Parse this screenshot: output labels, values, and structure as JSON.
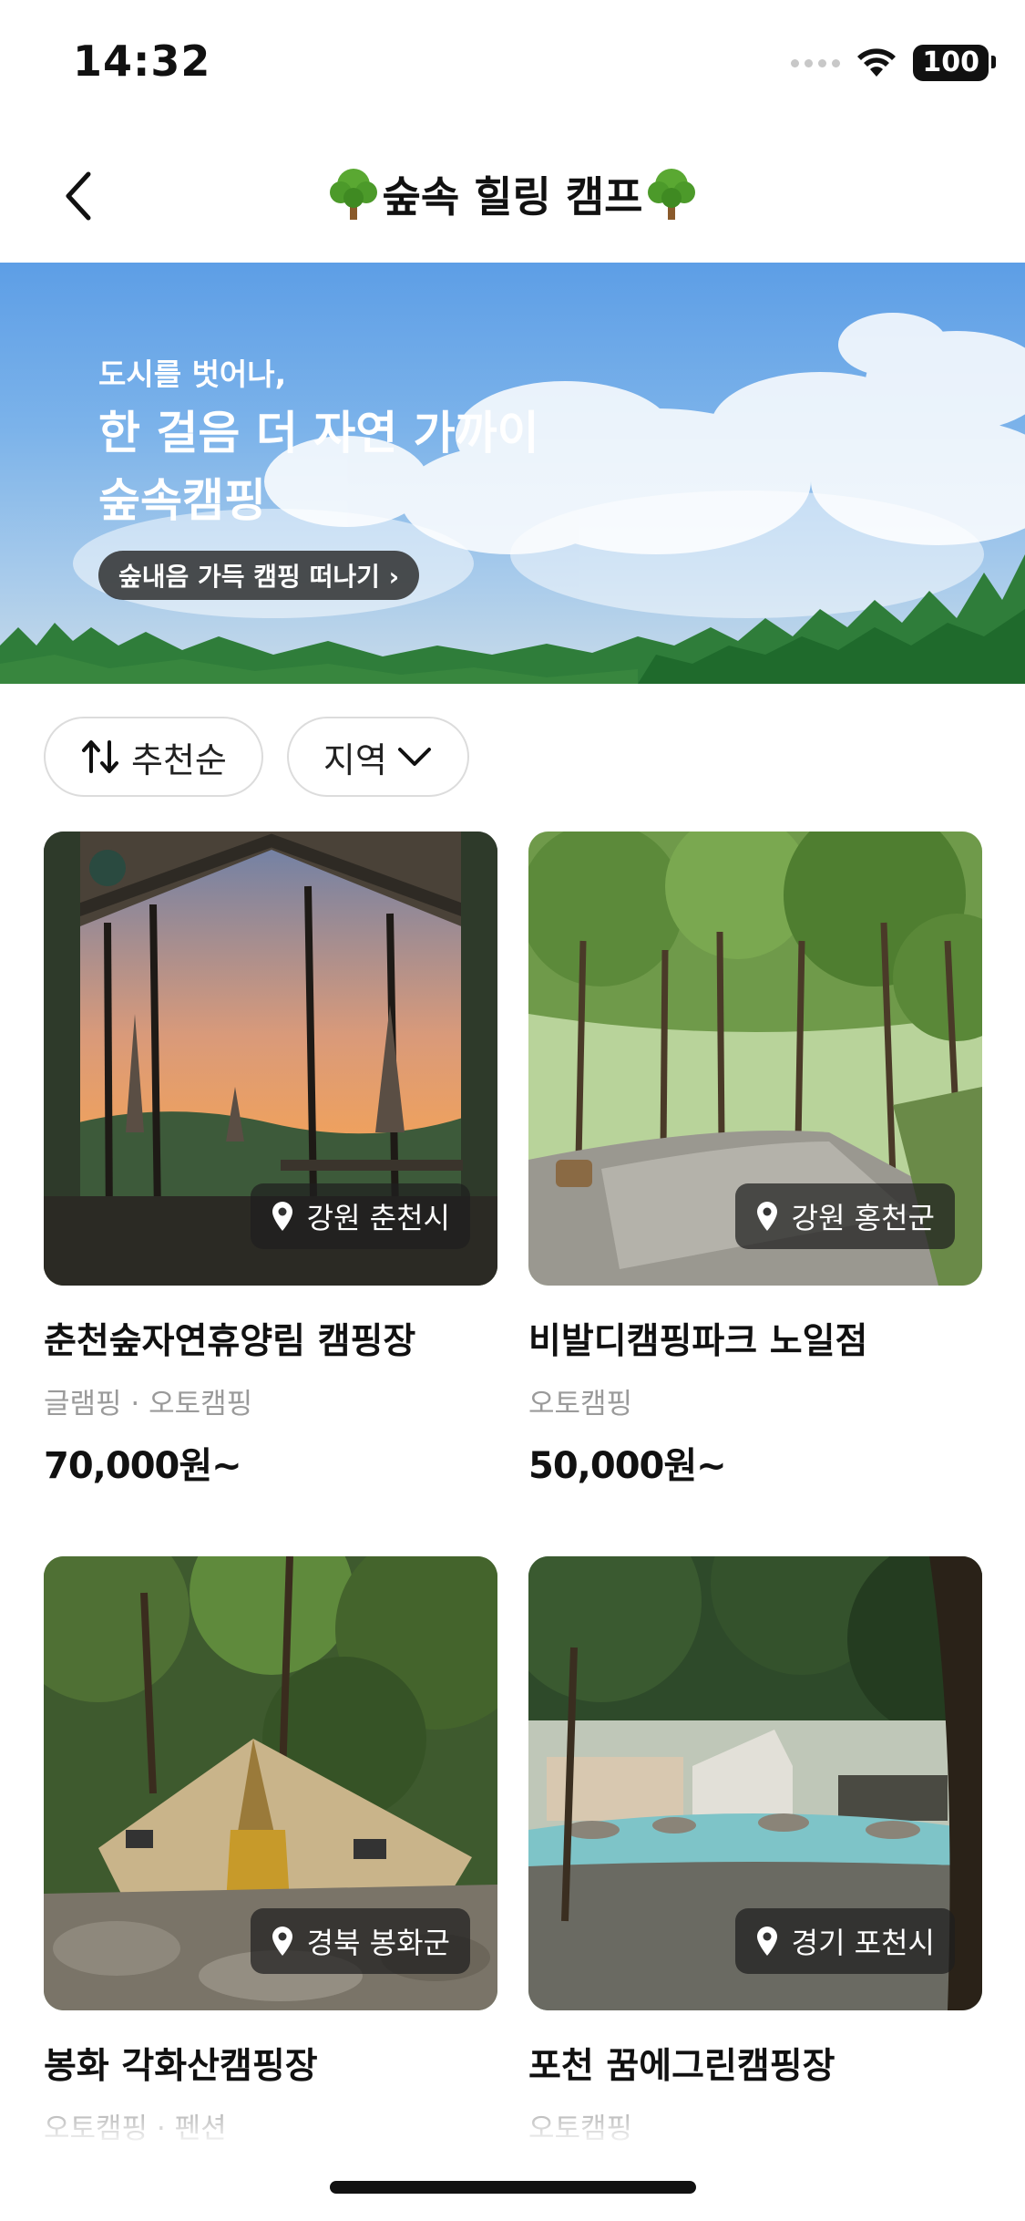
{
  "status_bar": {
    "time": "14:32",
    "battery": "100"
  },
  "nav": {
    "title_text": "숲속 힐링 캠프"
  },
  "banner": {
    "subtitle": "도시를 벗어나,",
    "title_line1": "한 걸음 더 자연 가까이",
    "title_line2": "숲속캠핑",
    "button_label": "숲내음 가득 캠핑 떠나기 ›"
  },
  "filters": [
    {
      "label": "추천순",
      "icon": "sort-icon"
    },
    {
      "label": "지역",
      "icon": "chevron-down-icon"
    }
  ],
  "cards": [
    {
      "location": "강원 춘천시",
      "name": "춘천숲자연휴양림 캠핑장",
      "type": "글램핑 · 오토캠핑",
      "price": "70,000원~"
    },
    {
      "location": "강원 홍천군",
      "name": "비발디캠핑파크 노일점",
      "type": "오토캠핑",
      "price": "50,000원~"
    },
    {
      "location": "경북 봉화군",
      "name": "봉화 각화산캠핑장",
      "type": "오토캠핑 · 펜션",
      "price": ""
    },
    {
      "location": "경기 포천시",
      "name": "포천 꿈에그린캠핑장",
      "type": "오토캠핑",
      "price": ""
    }
  ]
}
